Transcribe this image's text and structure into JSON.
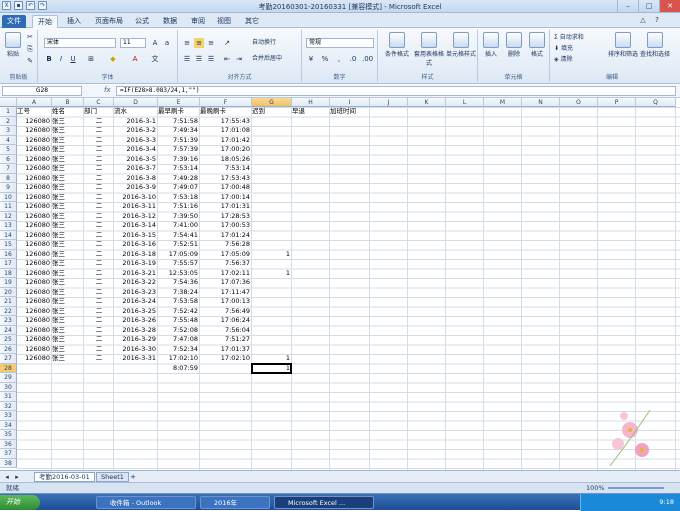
{
  "window": {
    "title": "考勤20160301-20160331 [兼容模式] - Microsoft Excel"
  },
  "tabs": [
    "文件",
    "开始",
    "插入",
    "页面布局",
    "公式",
    "数据",
    "审阅",
    "视图",
    "其它"
  ],
  "ribbon": {
    "paste": "粘贴",
    "clipboard": "剪贴板",
    "font_name": "宋体",
    "font_size": "11",
    "font_group": "字体",
    "wrap_text": "自动换行",
    "merge_center": "合并后居中",
    "align_group": "对齐方式",
    "number_format": "常规",
    "number_group": "数字",
    "cond_format": "条件格式",
    "table_format": "套用表格格式",
    "cell_styles": "单元格样式",
    "styles_group": "样式",
    "insert": "插入",
    "delete": "删除",
    "format": "格式",
    "cells_group": "单元格",
    "autosum": "自动求和",
    "fill": "填充",
    "clear": "清除",
    "sort_filter": "排序和筛选",
    "find_select": "查找和选择",
    "edit_group": "编辑"
  },
  "formula_bar": {
    "name_box": "G28",
    "fx": "fx",
    "formula": "=IF(E28>8.083/24,1,\"\")"
  },
  "columns": [
    "A",
    "B",
    "C",
    "D",
    "E",
    "F",
    "G",
    "H",
    "I",
    "J",
    "K",
    "L",
    "M",
    "N",
    "O",
    "P",
    "Q"
  ],
  "headers": {
    "A": "工号",
    "B": "姓名",
    "C": "部门",
    "D": "流水",
    "E": "最早刷卡",
    "F": "最晚刷卡",
    "G": "迟到",
    "H": "早退",
    "I": "加班时间"
  },
  "rows": [
    {
      "id": "126080",
      "name": "张三",
      "dept": "二",
      "date": "2016-3-1",
      "early": "7:51:58",
      "late": "17:55:43",
      "g": ""
    },
    {
      "id": "126080",
      "name": "张三",
      "dept": "二",
      "date": "2016-3-2",
      "early": "7:49:34",
      "late": "17:01:08",
      "g": ""
    },
    {
      "id": "126080",
      "name": "张三",
      "dept": "二",
      "date": "2016-3-3",
      "early": "7:51:39",
      "late": "17:01:42",
      "g": ""
    },
    {
      "id": "126080",
      "name": "张三",
      "dept": "二",
      "date": "2016-3-4",
      "early": "7:57:39",
      "late": "17:00:20",
      "g": ""
    },
    {
      "id": "126080",
      "name": "张三",
      "dept": "二",
      "date": "2016-3-5",
      "early": "7:39:16",
      "late": "18:05:26",
      "g": ""
    },
    {
      "id": "126080",
      "name": "张三",
      "dept": "二",
      "date": "2016-3-7",
      "early": "7:53:14",
      "late": "7:53:14",
      "g": ""
    },
    {
      "id": "126080",
      "name": "张三",
      "dept": "二",
      "date": "2016-3-8",
      "early": "7:49:28",
      "late": "17:53:43",
      "g": ""
    },
    {
      "id": "126080",
      "name": "张三",
      "dept": "二",
      "date": "2016-3-9",
      "early": "7:49:07",
      "late": "17:00:48",
      "g": ""
    },
    {
      "id": "126080",
      "name": "张三",
      "dept": "二",
      "date": "2016-3-10",
      "early": "7:53:18",
      "late": "17:00:14",
      "g": ""
    },
    {
      "id": "126080",
      "name": "张三",
      "dept": "二",
      "date": "2016-3-11",
      "early": "7:51:16",
      "late": "17:01:31",
      "g": ""
    },
    {
      "id": "126080",
      "name": "张三",
      "dept": "二",
      "date": "2016-3-12",
      "early": "7:39:50",
      "late": "17:28:53",
      "g": ""
    },
    {
      "id": "126080",
      "name": "张三",
      "dept": "二",
      "date": "2016-3-14",
      "early": "7:41:00",
      "late": "17:00:53",
      "g": ""
    },
    {
      "id": "126080",
      "name": "张三",
      "dept": "二",
      "date": "2016-3-15",
      "early": "7:54:41",
      "late": "17:01:24",
      "g": ""
    },
    {
      "id": "126080",
      "name": "张三",
      "dept": "二",
      "date": "2016-3-16",
      "early": "7:52:51",
      "late": "7:56:28",
      "g": ""
    },
    {
      "id": "126080",
      "name": "张三",
      "dept": "二",
      "date": "2016-3-18",
      "early": "17:05:09",
      "late": "17:05:09",
      "g": "1"
    },
    {
      "id": "126080",
      "name": "张三",
      "dept": "二",
      "date": "2016-3-19",
      "early": "7:55:57",
      "late": "7:56:37",
      "g": ""
    },
    {
      "id": "126080",
      "name": "张三",
      "dept": "二",
      "date": "2016-3-21",
      "early": "12:53:05",
      "late": "17:02:11",
      "g": "1"
    },
    {
      "id": "126080",
      "name": "张三",
      "dept": "二",
      "date": "2016-3-22",
      "early": "7:54:36",
      "late": "17:07:36",
      "g": ""
    },
    {
      "id": "126080",
      "name": "张三",
      "dept": "二",
      "date": "2016-3-23",
      "early": "7:38:24",
      "late": "17:11:47",
      "g": ""
    },
    {
      "id": "126080",
      "name": "张三",
      "dept": "二",
      "date": "2016-3-24",
      "early": "7:53:58",
      "late": "17:00:13",
      "g": ""
    },
    {
      "id": "126080",
      "name": "张三",
      "dept": "二",
      "date": "2016-3-25",
      "early": "7:52:42",
      "late": "7:56:49",
      "g": ""
    },
    {
      "id": "126080",
      "name": "张三",
      "dept": "二",
      "date": "2016-3-26",
      "early": "7:55:48",
      "late": "17:06:24",
      "g": ""
    },
    {
      "id": "126080",
      "name": "张三",
      "dept": "二",
      "date": "2016-3-28",
      "early": "7:52:08",
      "late": "7:56:04",
      "g": ""
    },
    {
      "id": "126080",
      "name": "张三",
      "dept": "二",
      "date": "2016-3-29",
      "early": "7:47:08",
      "late": "7:51:27",
      "g": ""
    },
    {
      "id": "126080",
      "name": "张三",
      "dept": "二",
      "date": "2016-3-30",
      "early": "7:52:34",
      "late": "17:01:37",
      "g": ""
    },
    {
      "id": "126080",
      "name": "张三",
      "dept": "二",
      "date": "2016-3-31",
      "early": "17:02:10",
      "late": "17:02:10",
      "g": "1"
    },
    {
      "id": "",
      "name": "",
      "dept": "",
      "date": "",
      "early": "8:07:59",
      "late": "",
      "g": "1"
    }
  ],
  "row_numbers": [
    "1",
    "2",
    "3",
    "4",
    "5",
    "6",
    "7",
    "8",
    "9",
    "10",
    "11",
    "12",
    "13",
    "14",
    "15",
    "16",
    "17",
    "18",
    "19",
    "20",
    "21",
    "22",
    "23",
    "24",
    "25",
    "26",
    "27",
    "28",
    "29",
    "30",
    "31",
    "32",
    "33",
    "34",
    "35",
    "36",
    "37",
    "38"
  ],
  "sheet_tabs": [
    "考勤2016-03-01",
    "Sheet1"
  ],
  "status": {
    "mode": "就绪",
    "zoom": "100%"
  },
  "taskbar": {
    "start": "开始",
    "items": [
      "收件箱 - Outlook",
      "2016年",
      "Microsoft Excel ..."
    ],
    "time": "9:18"
  }
}
